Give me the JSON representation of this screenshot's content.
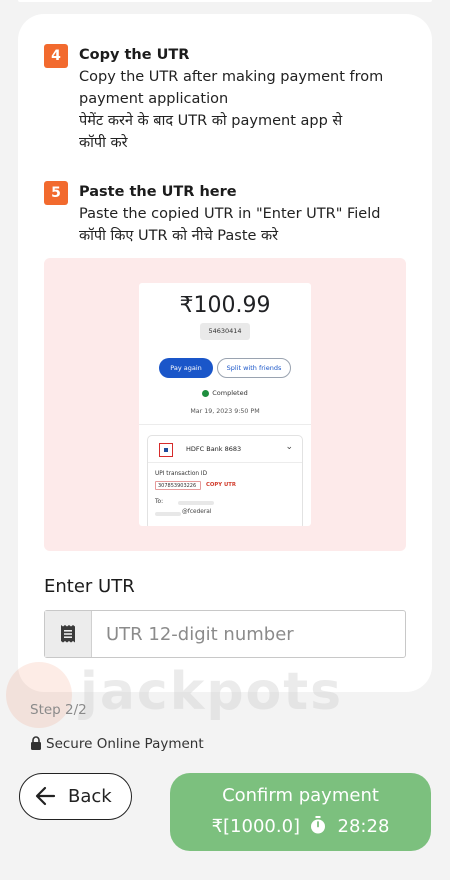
{
  "steps": [
    {
      "number": "4",
      "title": "Copy the UTR",
      "lines": [
        "Copy the UTR after making payment from",
        "payment application",
        "पेमेंट करने के बाद UTR को payment app से",
        "कॉपी करे"
      ]
    },
    {
      "number": "5",
      "title": "Paste the UTR here",
      "lines": [
        "Paste the copied UTR in \"Enter UTR\" Field",
        "कॉपी किए UTR को नीचे Paste करे"
      ]
    }
  ],
  "preview": {
    "amount": "₹100.99",
    "reference": "54630414",
    "pay_again": "Pay again",
    "split": "Split with friends",
    "status": "Completed",
    "date": "Mar 19, 2023 9:50 PM",
    "bank_name": "HDFC Bank 8683",
    "upi_label": "UPI transaction ID",
    "upi_id": "307853903226",
    "copy_label": "COPY UTR",
    "to_label": "To:",
    "vpa": "@fcederal"
  },
  "utr": {
    "label": "Enter UTR",
    "placeholder": "UTR 12-digit number",
    "value": ""
  },
  "watermark": "jackpots",
  "footer": {
    "step": "Step 2/2",
    "secure": "Secure Online Payment"
  },
  "buttons": {
    "back": "Back",
    "confirm_title": "Confirm payment",
    "confirm_amount": "₹[1000.0]",
    "confirm_timer": "28:28"
  },
  "colors": {
    "accent": "#f26a2e",
    "confirm": "#7cc07e",
    "preview_bg": "#fdeaea"
  }
}
